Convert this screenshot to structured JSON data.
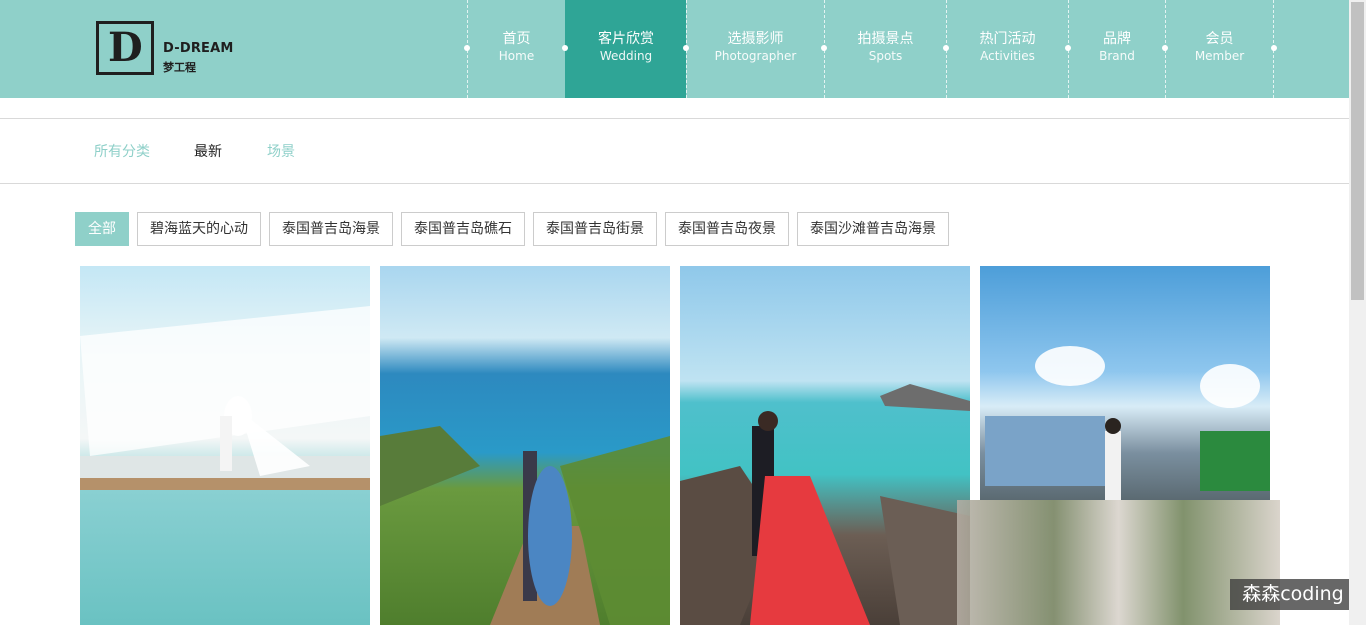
{
  "logo": {
    "mark": "D",
    "name": "D-DREAM",
    "subtitle": "梦工程"
  },
  "nav": {
    "items": [
      {
        "zh": "首页",
        "en": "Home",
        "active": false
      },
      {
        "zh": "客片欣赏",
        "en": "Wedding",
        "active": true
      },
      {
        "zh": "选摄影师",
        "en": "Photographer",
        "active": false
      },
      {
        "zh": "拍摄景点",
        "en": "Spots",
        "active": false
      },
      {
        "zh": "热门活动",
        "en": "Activities",
        "active": false
      },
      {
        "zh": "品牌",
        "en": "Brand",
        "active": false
      },
      {
        "zh": "会员",
        "en": "Member",
        "active": false
      }
    ]
  },
  "categories": {
    "all": "所有分类",
    "newest": "最新",
    "scene": "场景"
  },
  "filters": [
    {
      "label": "全部",
      "active": true
    },
    {
      "label": "碧海蓝天的心动",
      "active": false
    },
    {
      "label": "泰国普吉岛海景",
      "active": false
    },
    {
      "label": "泰国普吉岛礁石",
      "active": false
    },
    {
      "label": "泰国普吉岛街景",
      "active": false
    },
    {
      "label": "泰国普吉岛夜景",
      "active": false
    },
    {
      "label": "泰国沙滩普吉岛海景",
      "active": false
    }
  ],
  "watermark": "森森coding",
  "colors": {
    "accent": "#8fd0c9",
    "active_nav": "#2fa596",
    "text_dark": "#222222"
  }
}
